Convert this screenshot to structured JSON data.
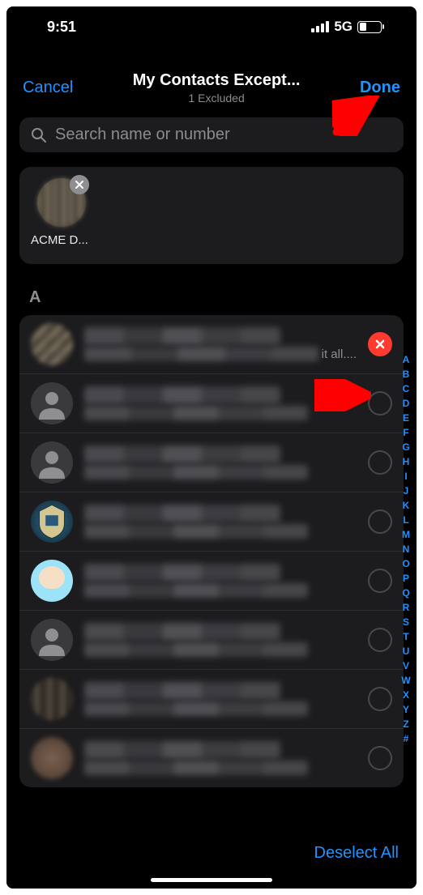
{
  "statusBar": {
    "time": "9:51",
    "network": "5G",
    "battery": "32"
  },
  "header": {
    "cancel": "Cancel",
    "title": "My Contacts Except...",
    "subtitle": "1 Excluded",
    "done": "Done"
  },
  "search": {
    "placeholder": "Search name or number"
  },
  "selectedChip": {
    "label": "ACME D..."
  },
  "sectionLetter": "A",
  "rows": [
    {
      "selected": true,
      "avatar": "pix1",
      "subtitleTail": "it all...."
    },
    {
      "selected": false,
      "avatar": "generic"
    },
    {
      "selected": false,
      "avatar": "generic"
    },
    {
      "selected": false,
      "avatar": "crest"
    },
    {
      "selected": false,
      "avatar": "finn"
    },
    {
      "selected": false,
      "avatar": "generic"
    },
    {
      "selected": false,
      "avatar": "pix2"
    },
    {
      "selected": false,
      "avatar": "pix3"
    }
  ],
  "indexLetters": [
    "A",
    "B",
    "C",
    "D",
    "E",
    "F",
    "G",
    "H",
    "I",
    "J",
    "K",
    "L",
    "M",
    "N",
    "O",
    "P",
    "Q",
    "R",
    "S",
    "T",
    "U",
    "V",
    "W",
    "X",
    "Y",
    "Z",
    "#"
  ],
  "footer": {
    "deselect": "Deselect All"
  },
  "colors": {
    "accent": "#2093ff",
    "danger": "#ff3b30"
  }
}
